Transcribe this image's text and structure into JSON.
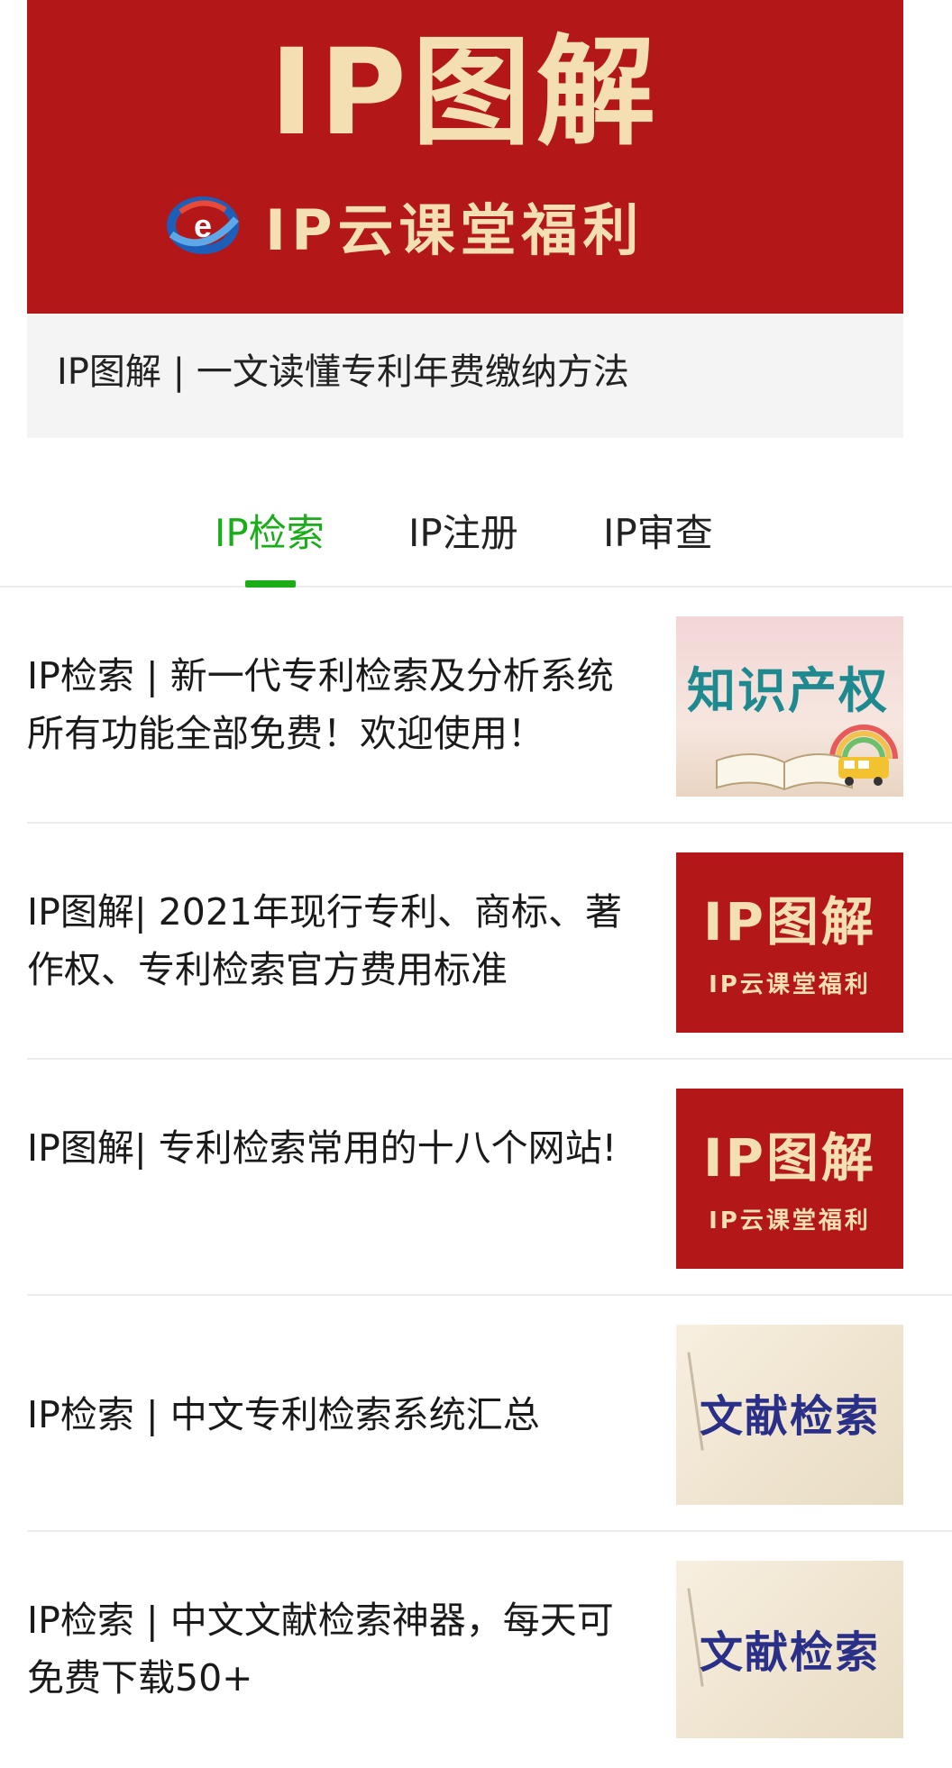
{
  "featured": {
    "banner_title": "IP图解",
    "banner_subtitle": "IP云课堂福利",
    "caption": "IP图解 | 一文读懂专利年费缴纳方法"
  },
  "tabs": [
    {
      "label": "IP检索",
      "active": true
    },
    {
      "label": "IP注册",
      "active": false
    },
    {
      "label": "IP审查",
      "active": false
    }
  ],
  "articles": [
    {
      "title": "IP检索 | 新一代专利检索及分析系统所有功能全部免费！欢迎使用！",
      "thumb": {
        "style": "education",
        "text": "知识产权"
      }
    },
    {
      "title": "IP图解| 2021年现行专利、商标、著作权、专利检索官方费用标准",
      "thumb": {
        "style": "red-banner",
        "text": "IP图解",
        "subtext": "IP云课堂福利"
      }
    },
    {
      "title": "IP图解| 专利检索常用的十八个网站!",
      "thumb": {
        "style": "red-banner",
        "text": "IP图解",
        "subtext": "IP云课堂福利"
      }
    },
    {
      "title": "IP检索 | 中文专利检索系统汇总",
      "thumb": {
        "style": "paper",
        "text": "文献检索"
      }
    },
    {
      "title": "IP检索 | 中文文献检索神器，每天可免费下载50+",
      "thumb": {
        "style": "paper",
        "text": "文献检索"
      }
    }
  ],
  "colors": {
    "brand_red": "#b41718",
    "banner_text": "#f4dfb3",
    "active_tab": "#1aad19",
    "paper_text": "#2a2f88"
  }
}
